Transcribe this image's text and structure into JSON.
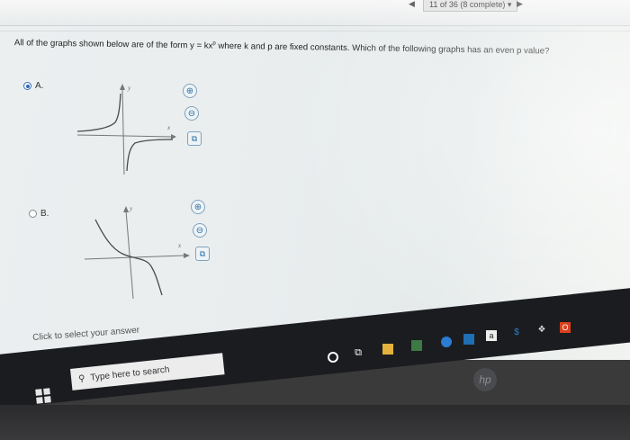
{
  "nav": {
    "counter": "11 of 36 (8 complete)",
    "prev_glyph": "◀",
    "next_glyph": "▶",
    "dropdown_glyph": "▾"
  },
  "question": {
    "text_before": "All of the graphs shown below are of the form y = kx",
    "superscript": "p",
    "text_after": " where k and p are fixed constants. Which of the following graphs has an even p value?"
  },
  "options": [
    {
      "letter": "A.",
      "selected": true,
      "axis_y": "y",
      "axis_x": "x"
    },
    {
      "letter": "B.",
      "selected": false,
      "axis_y": "y",
      "axis_x": "x"
    }
  ],
  "tools": {
    "zoom_in": "⊕",
    "zoom_out": "⊖",
    "popout": "⧉"
  },
  "hint": "Click to select your answer",
  "taskbar": {
    "search_placeholder": "Type here to search"
  },
  "colors": {
    "accent": "#2f68b6",
    "screen_bg": "#e9edee",
    "taskbar_bg": "#1b1c1f"
  },
  "brand": "hp"
}
